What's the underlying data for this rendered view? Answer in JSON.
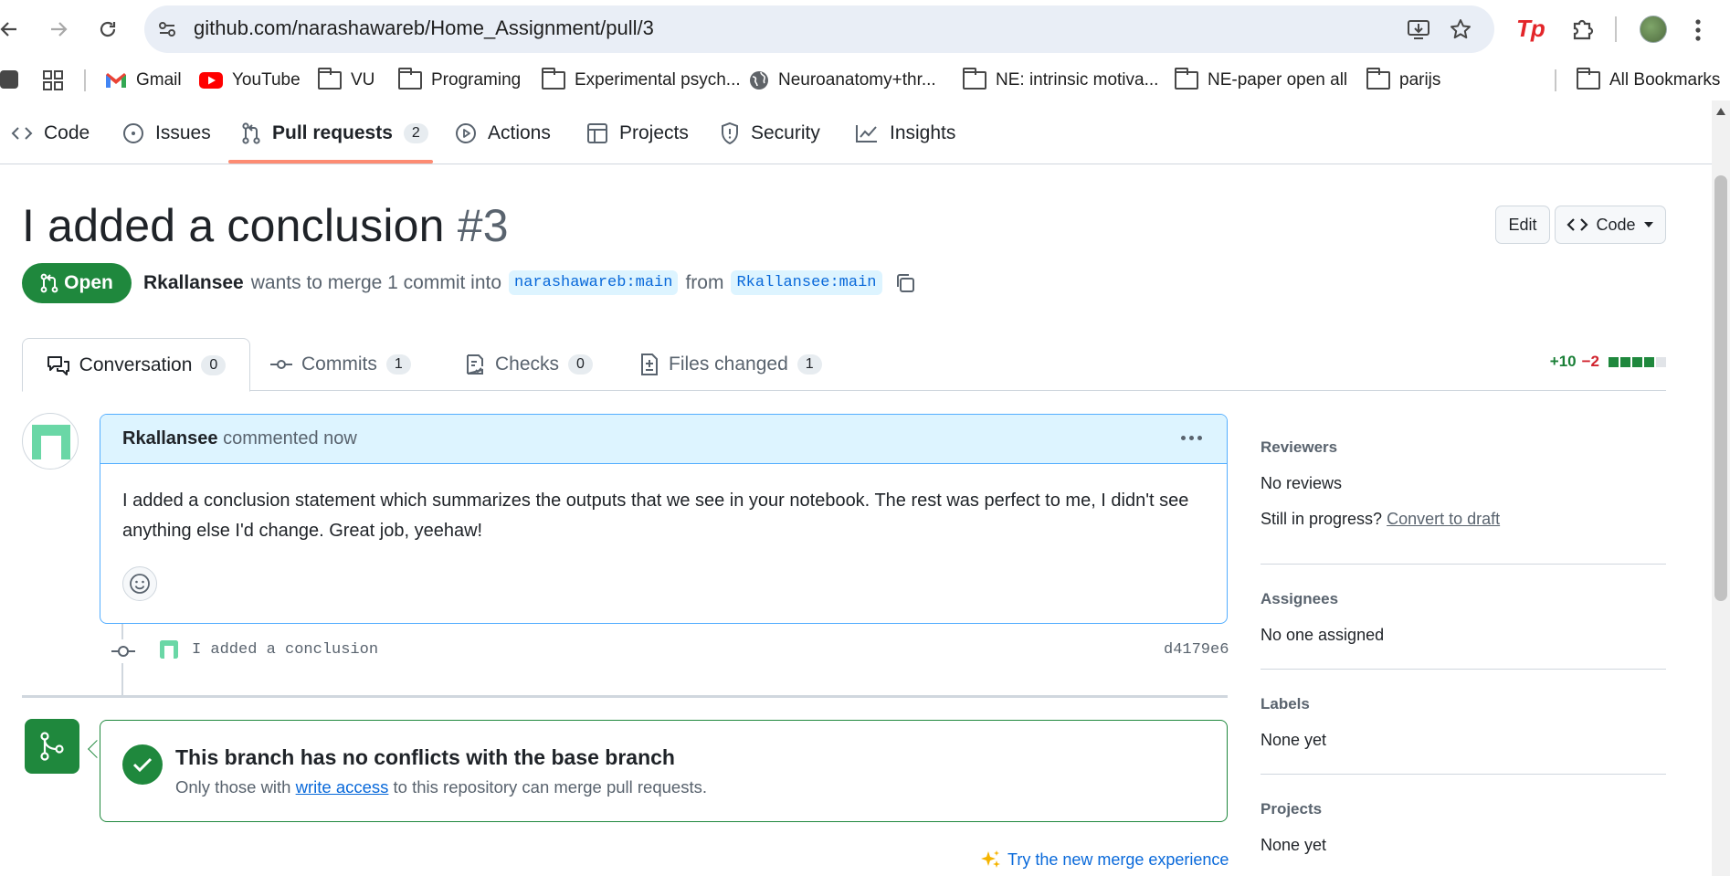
{
  "browser": {
    "url": "github.com/narashawareb/Home_Assignment/pull/3",
    "bookmarks": [
      {
        "label": "Gmail",
        "icon": "gmail-icon"
      },
      {
        "label": "YouTube",
        "icon": "youtube-icon"
      },
      {
        "label": "VU",
        "icon": "folder-icon"
      },
      {
        "label": "Programing",
        "icon": "folder-icon"
      },
      {
        "label": "Experimental psych...",
        "icon": "folder-icon"
      },
      {
        "label": "Neuroanatomy+thr...",
        "icon": "globe-icon"
      },
      {
        "label": "NE: intrinsic motiva...",
        "icon": "folder-icon"
      },
      {
        "label": "NE-paper open all",
        "icon": "folder-icon"
      },
      {
        "label": "parijs",
        "icon": "folder-icon"
      }
    ],
    "all_bookmarks": "All Bookmarks"
  },
  "repo_nav": {
    "tabs": [
      {
        "label": "Code"
      },
      {
        "label": "Issues"
      },
      {
        "label": "Pull requests",
        "count": "2"
      },
      {
        "label": "Actions"
      },
      {
        "label": "Projects"
      },
      {
        "label": "Security"
      },
      {
        "label": "Insights"
      }
    ]
  },
  "pr": {
    "title": "I added a conclusion",
    "number": "#3",
    "edit_label": "Edit",
    "code_label": "Code",
    "state": "Open",
    "author": "Rkallansee",
    "merge_text": "wants to merge 1 commit into",
    "base_branch": "narashawareb:main",
    "from_text": "from",
    "head_branch": "Rkallansee:main"
  },
  "pr_tabs": [
    {
      "label": "Conversation",
      "count": "0"
    },
    {
      "label": "Commits",
      "count": "1"
    },
    {
      "label": "Checks",
      "count": "0"
    },
    {
      "label": "Files changed",
      "count": "1"
    }
  ],
  "diffstat": {
    "additions": "+10",
    "deletions": "−2",
    "blocks": 5,
    "green_blocks": 4
  },
  "comment": {
    "author": "Rkallansee",
    "time": "commented now",
    "body": "I added a conclusion statement which summarizes the outputs that we see in your notebook. The rest was perfect to me, I didn't see anything else I'd change. Great job, yeehaw!"
  },
  "commit": {
    "message": "I added a conclusion",
    "sha": "d4179e6"
  },
  "merge": {
    "title": "This branch has no conflicts with the base branch",
    "sub_before": "Only those with",
    "sub_link": "write access",
    "sub_after": "to this repository can merge pull requests.",
    "new_experience": "Try the new merge experience"
  },
  "sidebar": {
    "reviewers": {
      "heading": "Reviewers",
      "value": "No reviews",
      "draft_prompt": "Still in progress?",
      "draft_link": "Convert to draft"
    },
    "assignees": {
      "heading": "Assignees",
      "value": "No one assigned"
    },
    "labels": {
      "heading": "Labels",
      "value": "None yet"
    },
    "projects": {
      "heading": "Projects",
      "value": "None yet"
    }
  },
  "colors": {
    "accent": "#0969da",
    "open_green": "#1f883d",
    "tab_underline": "#fd8c73",
    "comment_header": "#ddf4ff"
  }
}
